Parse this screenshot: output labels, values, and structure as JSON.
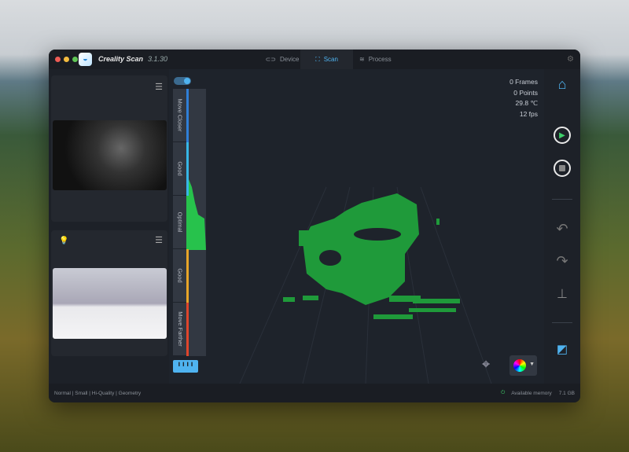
{
  "app": {
    "name": "Creality Scan",
    "version": "3.1.30"
  },
  "tabs": [
    {
      "label": "Device",
      "icon": "device-icon"
    },
    {
      "label": "Scan",
      "icon": "scan-icon"
    },
    {
      "label": "Process",
      "icon": "layers-icon"
    }
  ],
  "stats": {
    "frames": "0 Frames",
    "points": "0 Points",
    "temp": "29.8 ℃",
    "fps": "12 fps"
  },
  "gauge": [
    "Move Closer",
    "Good",
    "Optimal",
    "Good",
    "Move Farther"
  ],
  "gauge_colors": [
    "#2f7fd8",
    "#37b6e6",
    "#27c24c",
    "#e8a528",
    "#e0452b"
  ],
  "status": {
    "mode": "Normal | Small | Hi-Quality | Geometry",
    "memory_label": "Available memory",
    "memory_value": "7.1 GB"
  },
  "colors": {
    "accent": "#4fb3f0",
    "cloud": "#1f9a3a",
    "play": "#3ed06a"
  }
}
